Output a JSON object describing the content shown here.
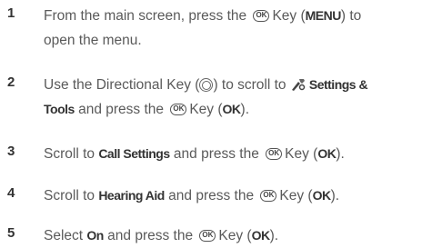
{
  "steps": [
    {
      "number": "1",
      "line1_a": "From the main screen, press the",
      "line1_b": "Key (",
      "line1_bold": "MENU",
      "line1_c": ") to",
      "line2": "open the menu."
    },
    {
      "number": "2",
      "line1_a": "Use the Directional Key (",
      "line1_b": ") to scroll to",
      "line1_bold": "Settings &",
      "line2_bold": "Tools",
      "line2_a": " and press the",
      "line2_b": "Key (",
      "line2_bold2": "OK",
      "line2_c": ")."
    },
    {
      "number": "3",
      "a": "Scroll to ",
      "bold": "Call Settings",
      "b": " and press the",
      "c": "Key (",
      "bold2": "OK",
      "d": ")."
    },
    {
      "number": "4",
      "a": "Scroll to ",
      "bold": "Hearing Aid",
      "b": " and press the",
      "c": "Key (",
      "bold2": "OK",
      "d": ")."
    },
    {
      "number": "5",
      "a": "Select ",
      "bold": "On",
      "b": " and press the",
      "c": "Key (",
      "bold2": "OK",
      "d": ")."
    }
  ],
  "ok_key_glyph": "OK",
  "icons": {
    "ok": "ok-key-icon",
    "directional": "directional-key-icon",
    "settings": "settings-tools-icon"
  }
}
